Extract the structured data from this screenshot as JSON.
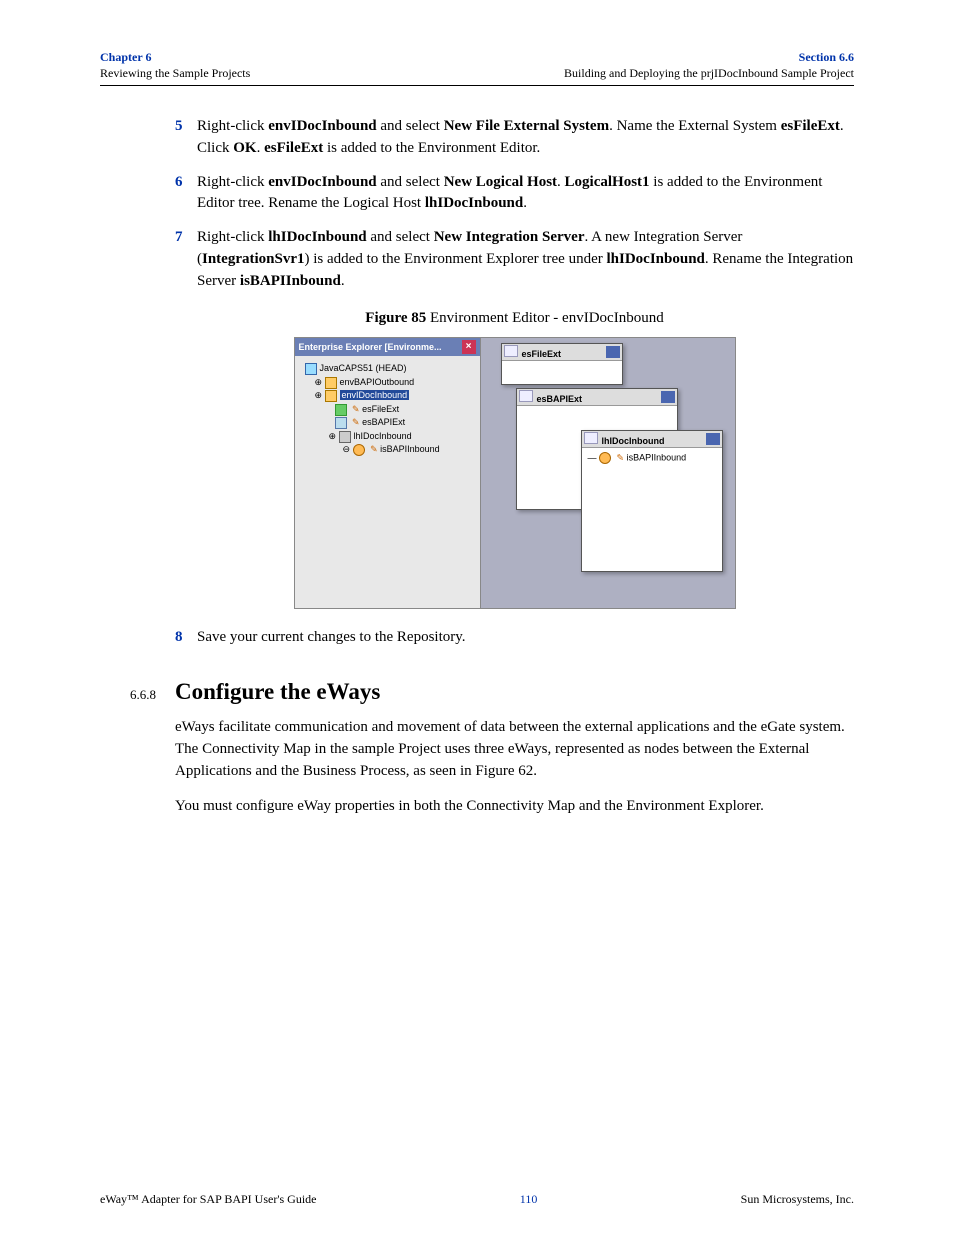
{
  "header": {
    "chapter": "Chapter 6",
    "left_sub": "Reviewing the Sample Projects",
    "section": "Section 6.6",
    "right_sub": "Building and Deploying the prjIDocInbound Sample Project"
  },
  "steps": {
    "s5num": "5",
    "s5a": "Right-click ",
    "s5b": "envIDocInbound",
    "s5c": " and select ",
    "s5d": "New File External System",
    "s5e": ". Name the External System ",
    "s5f": "esFileExt",
    "s5g": ". Click ",
    "s5h": "OK",
    "s5i": ". ",
    "s5j": "esFileExt",
    "s5k": " is added to the Environment Editor.",
    "s6num": "6",
    "s6a": "Right-click ",
    "s6b": "envIDocInbound",
    "s6c": " and select ",
    "s6d": "New Logical Host",
    "s6e": ". ",
    "s6f": "LogicalHost1",
    "s6g": " is added to the Environment Editor tree. Rename the Logical Host ",
    "s6h": "lhIDocInbound",
    "s6i": ".",
    "s7num": "7",
    "s7a": "Right-click ",
    "s7b": "lhIDocInbound",
    "s7c": " and select ",
    "s7d": "New Integration Server",
    "s7e": ". A new Integration Server (",
    "s7f": "IntegrationSvr1",
    "s7g": ") is added to the Environment Explorer tree under ",
    "s7h": "lhIDocInbound",
    "s7i": ". Rename the Integration Server ",
    "s7j": "isBAPIInbound",
    "s7k": ".",
    "s8num": "8",
    "s8txt": "Save your current changes to the Repository."
  },
  "figure": {
    "lead": "Figure 85",
    "caption": "   Environment Editor - envIDocInbound",
    "explorer_title": "Enterprise Explorer [Environme...",
    "tree": {
      "root": "JavaCAPS51 (HEAD)",
      "n1": "envBAPIOutbound",
      "n2": "envIDocInbound",
      "n2a": "esFileExt",
      "n2b": "esBAPIExt",
      "n2c": "lhIDocInbound",
      "n2c1": "isBAPIInbound"
    },
    "boxes": {
      "b1": "esFileExt",
      "b2": "esBAPIExt",
      "b3": "lhIDocInbound",
      "b3item": "isBAPIInbound"
    }
  },
  "section668": {
    "no": "6.6.8",
    "title": "Configure the eWays",
    "p1": "eWays facilitate communication and movement of data between the external applications and the eGate system. The Connectivity Map in the sample Project uses three eWays, represented as nodes between the External Applications and the Business Process, as seen in Figure 62.",
    "p2": "You must configure eWay properties in both the Connectivity Map and the Environment Explorer."
  },
  "footer": {
    "left": "eWay™ Adapter for SAP BAPI User's Guide",
    "mid": "110",
    "right": "Sun Microsystems, Inc."
  }
}
